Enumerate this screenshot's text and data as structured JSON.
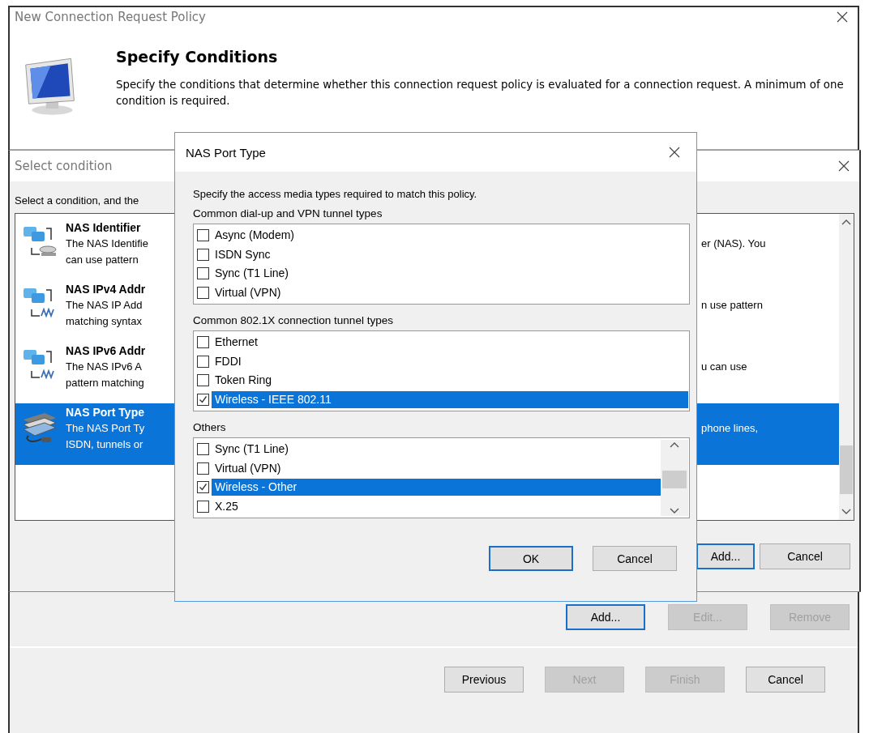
{
  "window": {
    "title": "New Connection Request Policy"
  },
  "header": {
    "title": "Specify Conditions",
    "description": "Specify the conditions that determine whether this connection request policy is evaluated for a connection request. A minimum of one condition is required."
  },
  "condition_buttons": [
    {
      "label": "Add...",
      "disabled": false,
      "default": true
    },
    {
      "label": "Edit...",
      "disabled": true,
      "default": false
    },
    {
      "label": "Remove",
      "disabled": true,
      "default": false
    }
  ],
  "nav_buttons": [
    {
      "label": "Previous",
      "disabled": false
    },
    {
      "label": "Next",
      "disabled": true
    },
    {
      "label": "Finish",
      "disabled": true
    },
    {
      "label": "Cancel",
      "disabled": false
    }
  ],
  "select_dialog": {
    "title": "Select condition",
    "prompt": "Select a condition, and the",
    "conditions": [
      {
        "kind": "server",
        "name": "NAS Identifier",
        "lines": [
          "The NAS Identifie",
          "can use pattern"
        ],
        "right_text": "er (NAS). You",
        "selected": false
      },
      {
        "kind": "address",
        "name": "NAS IPv4 Addr",
        "lines": [
          "The NAS IP Add",
          "matching syntax"
        ],
        "right_text": "n use pattern",
        "selected": false
      },
      {
        "kind": "address",
        "name": "NAS IPv6 Addr",
        "lines": [
          "The NAS IPv6 A",
          "pattern matching"
        ],
        "right_text": "u can use",
        "selected": false
      },
      {
        "kind": "port",
        "name": "NAS Port Type",
        "lines": [
          "The NAS Port Ty",
          "ISDN, tunnels or"
        ],
        "right_text": "phone lines,",
        "selected": true
      }
    ],
    "buttons": [
      {
        "label": "Add...",
        "default": true
      },
      {
        "label": "Cancel",
        "default": false
      }
    ]
  },
  "port_dialog": {
    "title": "NAS Port Type",
    "instruction": "Specify the access media types required to match this policy.",
    "groups": [
      {
        "label": "Common dial-up and VPN tunnel types",
        "kind": "list",
        "items": [
          {
            "label": "Async (Modem)",
            "checked": false,
            "selected": false
          },
          {
            "label": "ISDN Sync",
            "checked": false,
            "selected": false
          },
          {
            "label": "Sync (T1 Line)",
            "checked": false,
            "selected": false
          },
          {
            "label": "Virtual (VPN)",
            "checked": false,
            "selected": false
          }
        ]
      },
      {
        "label": "Common 802.1X connection tunnel types",
        "kind": "list",
        "items": [
          {
            "label": "Ethernet",
            "checked": false,
            "selected": false
          },
          {
            "label": "FDDI",
            "checked": false,
            "selected": false
          },
          {
            "label": "Token Ring",
            "checked": false,
            "selected": false
          },
          {
            "label": "Wireless - IEEE 802.11",
            "checked": true,
            "selected": true
          }
        ]
      },
      {
        "label": "Others",
        "kind": "scroll-list",
        "items": [
          {
            "label": "Sync (T1 Line)",
            "checked": false,
            "selected": false
          },
          {
            "label": "Virtual (VPN)",
            "checked": false,
            "selected": false
          },
          {
            "label": "Wireless - Other",
            "checked": true,
            "selected": true
          },
          {
            "label": "X.25",
            "checked": false,
            "selected": false
          }
        ]
      }
    ],
    "buttons": [
      {
        "label": "OK",
        "default": true
      },
      {
        "label": "Cancel",
        "default": false
      }
    ]
  }
}
